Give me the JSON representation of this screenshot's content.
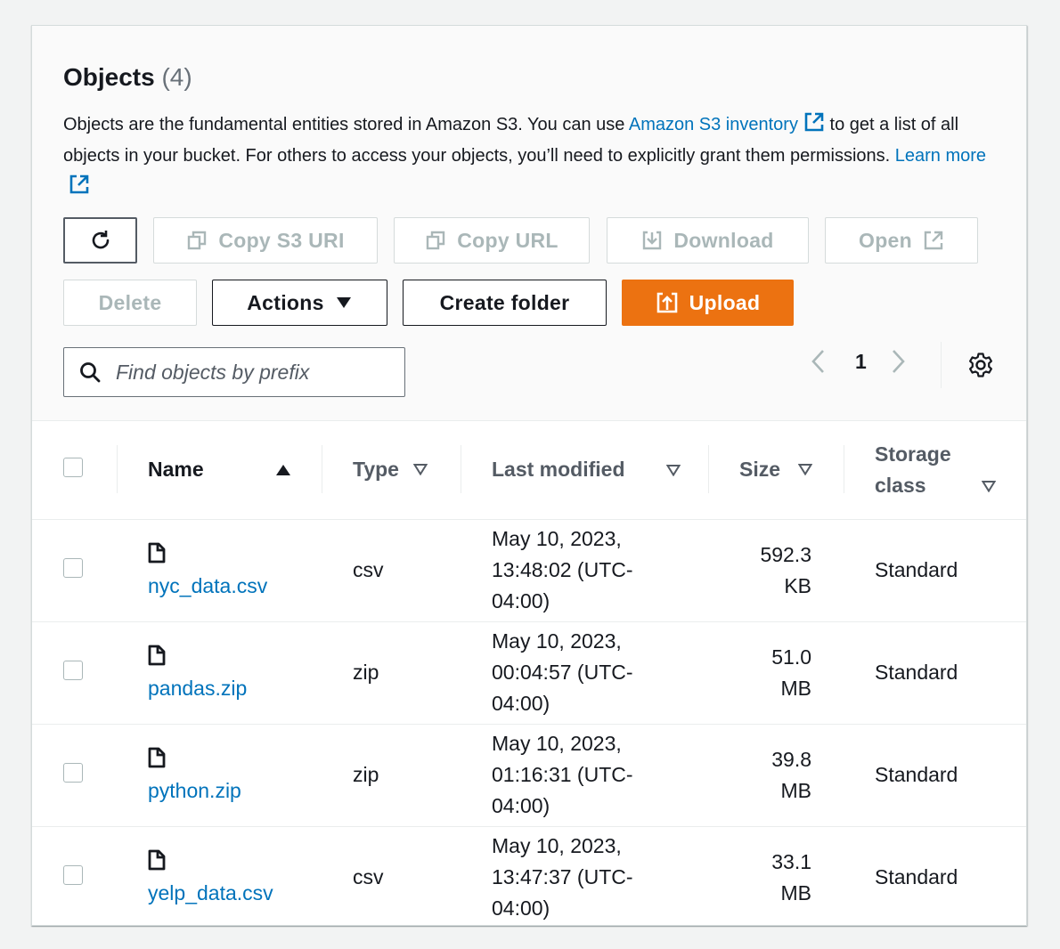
{
  "header": {
    "title": "Objects",
    "count": "(4)",
    "description_part1": "Objects are the fundamental entities stored in Amazon S3. You can use ",
    "inventory_link": "Amazon S3 inventory",
    "description_part2": " to get a list of all objects in your bucket. For others to access your objects, you’ll need to explicitly grant them permissions. ",
    "learn_more": "Learn more"
  },
  "toolbar": {
    "refresh": "refresh-icon",
    "copy_s3_uri": "Copy S3 URI",
    "copy_url": "Copy URL",
    "download": "Download",
    "open": "Open",
    "delete": "Delete",
    "actions": "Actions",
    "create_folder": "Create folder",
    "upload": "Upload"
  },
  "search": {
    "placeholder": "Find objects by prefix",
    "value": ""
  },
  "pagination": {
    "current_page": "1"
  },
  "colors": {
    "accent": "#ec7211",
    "link": "#0073bb",
    "text": "#16191f",
    "muted": "#545b64"
  },
  "table": {
    "columns": [
      "Name",
      "Type",
      "Last modified",
      "Size",
      "Storage class"
    ],
    "rows": [
      {
        "name": "nyc_data.csv",
        "type": "csv",
        "modified": [
          "May 10, 2023,",
          "13:48:02 (UTC-",
          "04:00)"
        ],
        "size": [
          "592.3",
          "KB"
        ],
        "storage": "Standard"
      },
      {
        "name": "pandas.zip",
        "type": "zip",
        "modified": [
          "May 10, 2023,",
          "00:04:57 (UTC-",
          "04:00)"
        ],
        "size": [
          "51.0",
          "MB"
        ],
        "storage": "Standard"
      },
      {
        "name": "python.zip",
        "type": "zip",
        "modified": [
          "May 10, 2023,",
          "01:16:31 (UTC-",
          "04:00)"
        ],
        "size": [
          "39.8",
          "MB"
        ],
        "storage": "Standard"
      },
      {
        "name": "yelp_data.csv",
        "type": "csv",
        "modified": [
          "May 10, 2023,",
          "13:47:37 (UTC-",
          "04:00)"
        ],
        "size": [
          "33.1",
          "MB"
        ],
        "storage": "Standard"
      }
    ]
  }
}
